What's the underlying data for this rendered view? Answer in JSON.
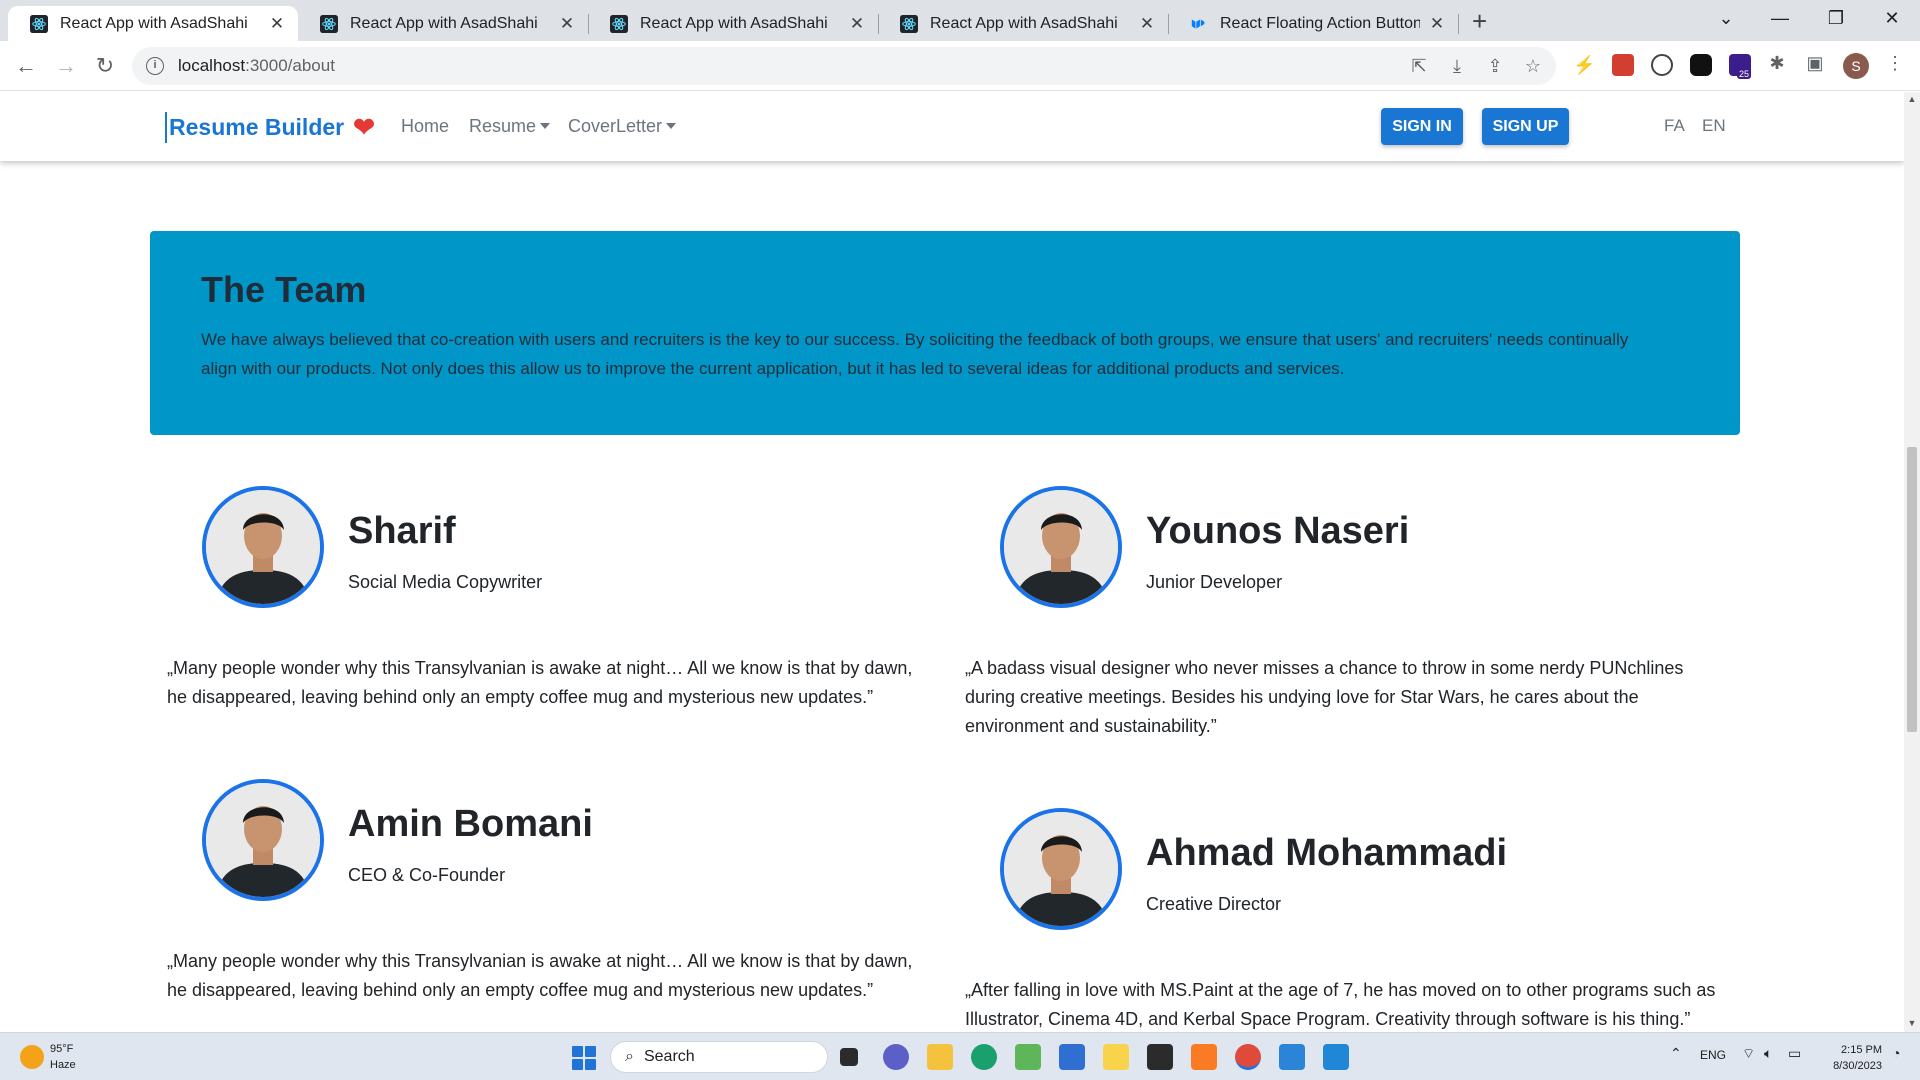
{
  "browser": {
    "tabs": [
      {
        "title": "React App with AsadShahi",
        "active": true
      },
      {
        "title": "React App with AsadShahi",
        "active": false
      },
      {
        "title": "React App with AsadShahi",
        "active": false
      },
      {
        "title": "React App with AsadShahi",
        "active": false
      },
      {
        "title": "React Floating Action Button (FAB",
        "active": false
      }
    ],
    "url_host": "localhost",
    "url_path": ":3000/about",
    "profile_initial": "S",
    "extension_badge": "25"
  },
  "site": {
    "brand": "Resume Builder",
    "nav": {
      "home": "Home",
      "resume": "Resume",
      "coverletter": "CoverLetter",
      "sign_in": "SIGN IN",
      "sign_up": "SIGN UP",
      "lang_fa": "FA",
      "lang_en": "EN"
    },
    "hero": {
      "title": "The Team",
      "text": "We have always believed that co-creation with users and recruiters is the key to our success. By soliciting the feedback of both groups, we ensure that users' and recruiters' needs continually align with our products. Not only does this allow us to improve the current application, but it has led to several ideas for additional products and services."
    },
    "team": [
      {
        "name": "Sharif",
        "role": "Social Media Copywriter",
        "quote": "„Many people wonder why this Transylvanian is awake at night… All we know is that by dawn, he disappeared, leaving behind only an empty coffee mug and mysterious new updates.”"
      },
      {
        "name": "Younos Naseri",
        "role": "Junior Developer",
        "quote": "„A badass visual designer who never misses a chance to throw in some nerdy PUNchlines during creative meetings. Besides his undying love for Star Wars, he cares about the environment and sustainability.”"
      },
      {
        "name": "Amin Bomani",
        "role": "CEO & Co-Founder",
        "quote": "„Many people wonder why this Transylvanian is awake at night… All we know is that by dawn, he disappeared, leaving behind only an empty coffee mug and mysterious new updates.”"
      },
      {
        "name": "Ahmad Mohammadi",
        "role": "Creative Director",
        "quote": "„After falling in love with MS.Paint at the age of 7, he has moved on to other programs such as Illustrator, Cinema 4D, and Kerbal Space Program. Creativity through software is his thing.”"
      }
    ]
  },
  "taskbar": {
    "weather_temp": "95°F",
    "weather_cond": "Haze",
    "search_label": "Search",
    "lang": "ENG",
    "time": "2:15 PM",
    "date": "8/30/2023"
  },
  "colors": {
    "brand_blue": "#1976d2",
    "hero_bg": "#0096c7",
    "avatar_ring": "#1a73e8",
    "heart": "#e53935"
  }
}
